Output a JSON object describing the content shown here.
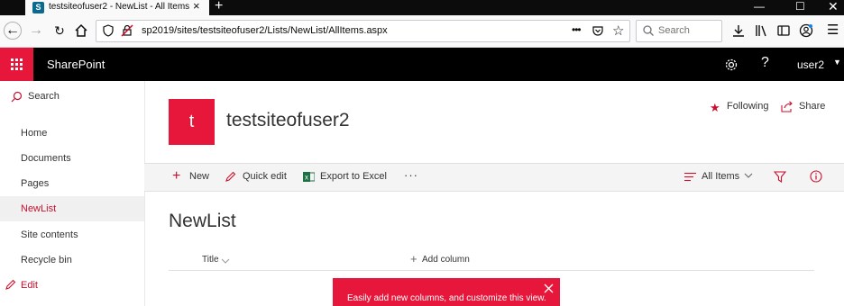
{
  "browser": {
    "tab_title": "testsiteofuser2 - NewList - All Items",
    "tab_favicon_letter": "S",
    "url": "sp2019/sites/testsiteofuser2/Lists/NewList/AllItems.aspx",
    "search_placeholder": "Search",
    "page_actions_glyph": "•••"
  },
  "suite": {
    "brand": "SharePoint",
    "help_glyph": "?",
    "user": "user2",
    "accent_color": "#e6173a"
  },
  "leftnav": {
    "search_label": "Search",
    "items": [
      {
        "label": "Home"
      },
      {
        "label": "Documents"
      },
      {
        "label": "Pages"
      },
      {
        "label": "NewList",
        "selected": true
      },
      {
        "label": "Site contents"
      },
      {
        "label": "Recycle bin"
      }
    ],
    "edit_label": "Edit"
  },
  "site": {
    "logo_letter": "t",
    "title": "testsiteofuser2",
    "following_label": "Following",
    "share_label": "Share"
  },
  "commandbar": {
    "new_label": "New",
    "quick_edit_label": "Quick edit",
    "export_label": "Export to Excel",
    "more_glyph": "···",
    "view_label": "All Items"
  },
  "list": {
    "title": "NewList",
    "columns": [
      "Title"
    ],
    "add_column_label": "Add column"
  },
  "teaching_bubble": {
    "text": "Easily add new columns, and customize this view."
  }
}
